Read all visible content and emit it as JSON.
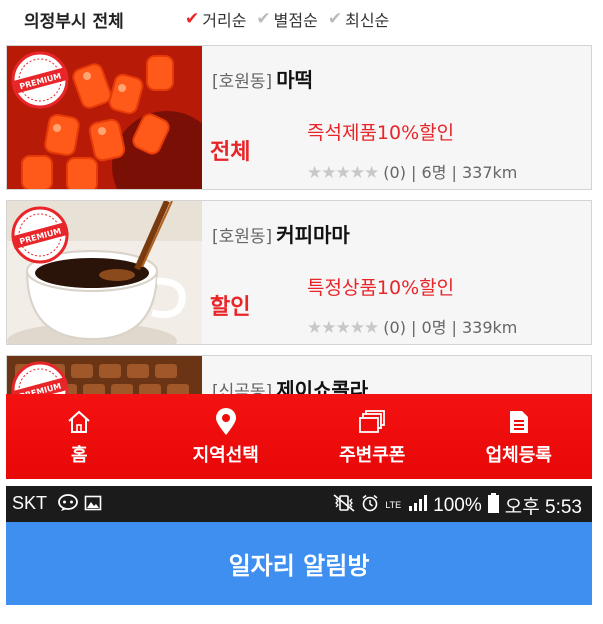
{
  "filter": {
    "region": "의정부시 전체",
    "sorts": [
      {
        "label": "거리순",
        "active": true
      },
      {
        "label": "별점순",
        "active": false
      },
      {
        "label": "최신순",
        "active": false
      }
    ]
  },
  "badge_text": "PREMIUM",
  "cards": [
    {
      "district": "[호원동]",
      "name": "마떡",
      "tag": "전체",
      "promo": "즉석제품10%할인",
      "stars": "★★★★★",
      "stats": "(0) | 6명 | 337km"
    },
    {
      "district": "[호원동]",
      "name": "커피마마",
      "tag": "할인",
      "promo": "특정상품10%할인",
      "stars": "★★★★★",
      "stats": "(0) | 0명 | 339km"
    },
    {
      "district": "[신곡동]",
      "name": "제이쇼콜라"
    }
  ],
  "nav": [
    {
      "label": "홈",
      "icon": "home-icon"
    },
    {
      "label": "지역선택",
      "icon": "location-pin-icon"
    },
    {
      "label": "주변쿠폰",
      "icon": "coupons-icon"
    },
    {
      "label": "업체등록",
      "icon": "document-icon"
    }
  ],
  "status_bar": {
    "carrier": "SKT",
    "battery": "100%",
    "time": "오후 5:53",
    "network": "LTE"
  },
  "app_header": {
    "title": "일자리 알림방"
  },
  "colors": {
    "accent_red": "#e8262a",
    "header_blue": "#3e8ff0",
    "status_bg": "#1b1b1b"
  }
}
